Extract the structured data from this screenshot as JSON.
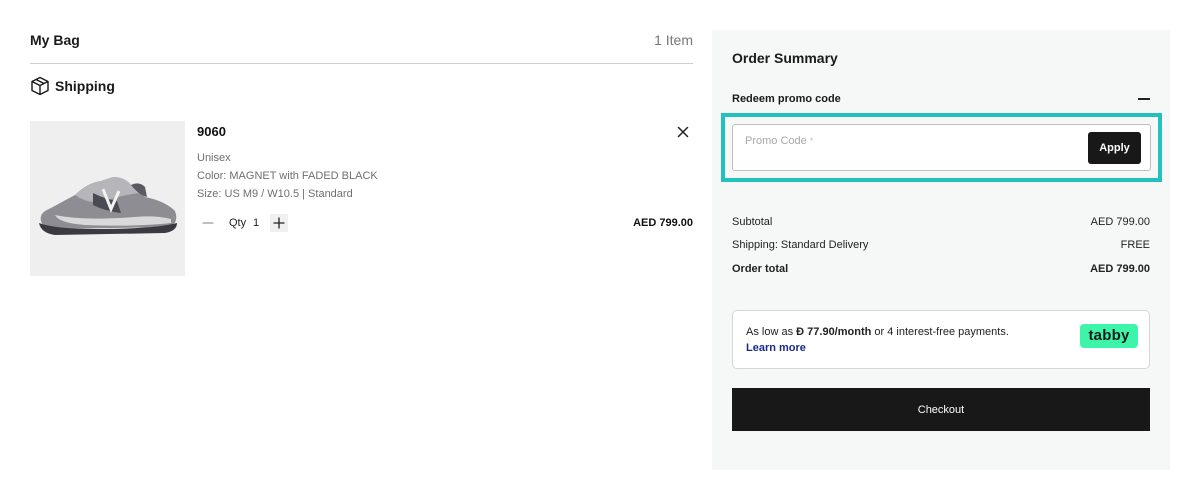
{
  "bag": {
    "title": "My Bag",
    "count": "1 Item",
    "shipping_label": "Shipping"
  },
  "product": {
    "name": "9060",
    "gender": "Unisex",
    "color": "Color: MAGNET with FADED BLACK",
    "size": "Size: US M9 / W10.5 | Standard",
    "qty_label": "Qty",
    "qty_value": "1",
    "price": "AED 799.00"
  },
  "summary": {
    "title": "Order Summary",
    "promo_header": "Redeem promo code",
    "promo_placeholder": "Promo Code",
    "promo_asterisk": "*",
    "apply_label": "Apply",
    "subtotal_label": "Subtotal",
    "subtotal_value": "AED 799.00",
    "shipping_label": "Shipping: Standard Delivery",
    "shipping_value": "FREE",
    "total_label": "Order total",
    "total_value": "AED 799.00",
    "checkout_label": "Checkout"
  },
  "tabby": {
    "prefix": "As low as",
    "currency_symbol": "Đ",
    "amount": "77.90/month",
    "suffix": "or 4 interest-free payments.",
    "learn_more": "Learn more",
    "logo": "tabby"
  },
  "icons": [
    "box-icon",
    "close-icon",
    "minus-icon",
    "plus-icon",
    "collapse-icon"
  ],
  "colors": {
    "highlight": "#22c1bd",
    "button": "#181818",
    "summary_bg": "#f6f7f7",
    "tabby_brand": "#3cf5a8",
    "link": "#1a2a8a"
  }
}
